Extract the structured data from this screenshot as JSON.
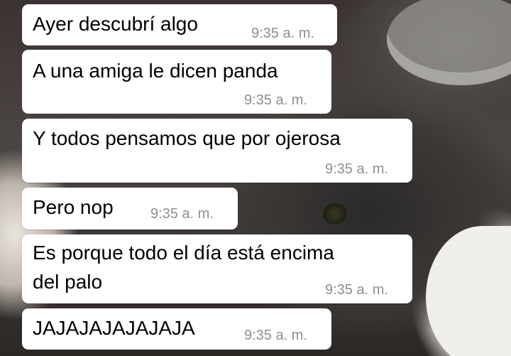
{
  "chat": {
    "messages": [
      {
        "text": "Ayer descubrí algo",
        "time": "9:35 a. m."
      },
      {
        "text": "A una amiga le dicen panda",
        "time": "9:35 a. m."
      },
      {
        "text": "Y todos pensamos que por ojerosa",
        "time": "9:35 a. m."
      },
      {
        "text": "Pero nop",
        "time": "9:35 a. m."
      },
      {
        "text_line1": "Es porque todo el día está encima",
        "text_line2": "del palo",
        "time": "9:35 a. m."
      },
      {
        "text": "JAJAJAJAJAJAJA",
        "time": "9:35 a. m."
      }
    ]
  }
}
